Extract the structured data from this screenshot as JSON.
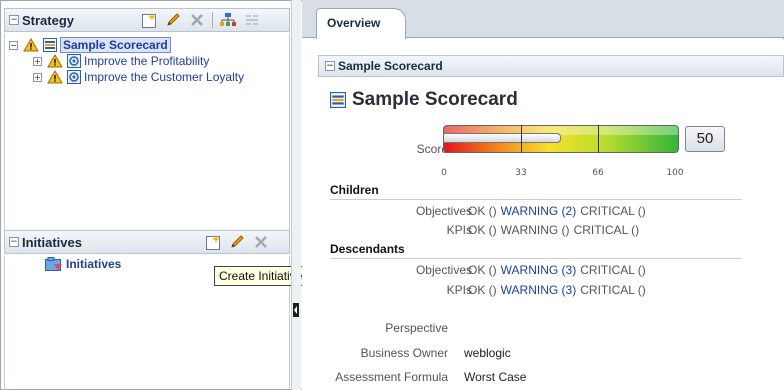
{
  "strategy": {
    "title": "Strategy",
    "tree": [
      {
        "label": "Sample Scorecard",
        "selected": true
      },
      {
        "label": "Improve the Profitability"
      },
      {
        "label": "Improve the Customer Loyalty"
      }
    ]
  },
  "initiatives": {
    "title": "Initiatives",
    "root_label": "Initiatives",
    "tooltip": "Create Initiative"
  },
  "tabs": [
    {
      "label": "Overview"
    }
  ],
  "overview": {
    "section_title": "Sample Scorecard",
    "page_title": "Sample Scorecard",
    "score_label": "Score",
    "score_value": "50",
    "gauge": {
      "min": 0,
      "max": 100,
      "value": 50,
      "ticks": [
        "0",
        "33",
        "66",
        "100"
      ]
    },
    "children": {
      "heading": "Children",
      "rows": [
        {
          "label": "Objectives",
          "ok": "OK ()",
          "warning": "WARNING (2)",
          "critical": "CRITICAL ()"
        },
        {
          "label": "KPIs",
          "ok": "OK ()",
          "warning": "WARNING ()",
          "critical": "CRITICAL ()"
        }
      ]
    },
    "descendants": {
      "heading": "Descendants",
      "rows": [
        {
          "label": "Objectives",
          "ok": "OK ()",
          "warning": "WARNING (3)",
          "critical": "CRITICAL ()"
        },
        {
          "label": "KPIs",
          "ok": "OK ()",
          "warning": "WARNING (3)",
          "critical": "CRITICAL ()"
        }
      ]
    },
    "properties": [
      {
        "label": "Perspective",
        "value": ""
      },
      {
        "label": "Business Owner",
        "value": "weblogic"
      },
      {
        "label": "Assessment Formula",
        "value": "Worst Case"
      }
    ]
  },
  "colors": {
    "link": "#1f3f9c",
    "header": "#1b2b3f",
    "warning": "#f3c21b"
  }
}
